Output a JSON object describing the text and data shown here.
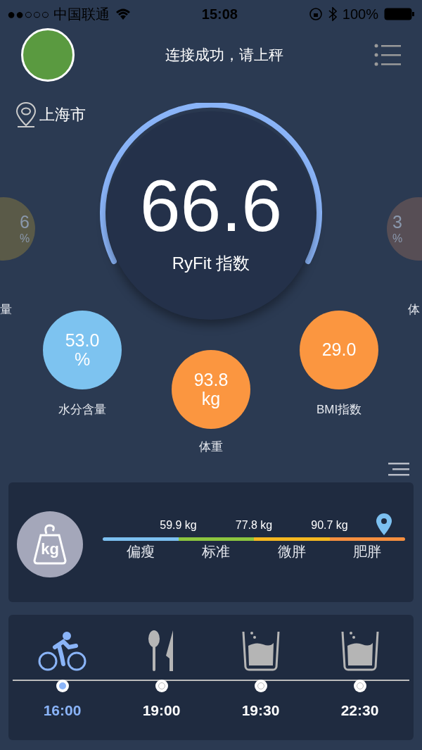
{
  "status_bar": {
    "carrier": "●●○○○ 中国联通",
    "time": "15:08",
    "battery": "100%"
  },
  "header": {
    "title": "连接成功，请上秤"
  },
  "location": "上海市",
  "gauge": {
    "value": "66.6",
    "label": "RyFit 指数"
  },
  "side_metrics": [
    {
      "value": "6",
      "unit": "%",
      "label": "量",
      "color": "#5a5a48"
    },
    {
      "value": "3",
      "unit": "%",
      "label": "体",
      "color": "#574e55"
    }
  ],
  "metrics": [
    {
      "value": "53.0",
      "unit": "%",
      "label": "水分含量",
      "color": "#7dc3f0"
    },
    {
      "value": "93.8",
      "unit": "kg",
      "label": "体重",
      "color": "#fb9640"
    },
    {
      "value": "29.0",
      "label": "BMI指数",
      "color": "#fb9640"
    }
  ],
  "weight_scale": {
    "icon_label": "kg",
    "thresholds": [
      "59.9 kg",
      "77.8 kg",
      "90.7 kg"
    ],
    "marker": {
      "level": 0.93
    },
    "segments": [
      {
        "label": "偏瘦",
        "color": "#7cc0f0"
      },
      {
        "label": "标准",
        "color": "#8cc63f"
      },
      {
        "label": "微胖",
        "color": "#f5b820"
      },
      {
        "label": "肥胖",
        "color": "#f58f3f"
      }
    ]
  },
  "timeline": [
    {
      "kind": "bike",
      "time": "16:00",
      "selected": true
    },
    {
      "kind": "meal",
      "time": "19:00",
      "selected": false
    },
    {
      "kind": "water",
      "time": "19:30",
      "selected": false
    },
    {
      "kind": "water",
      "time": "22:30",
      "selected": false
    }
  ]
}
